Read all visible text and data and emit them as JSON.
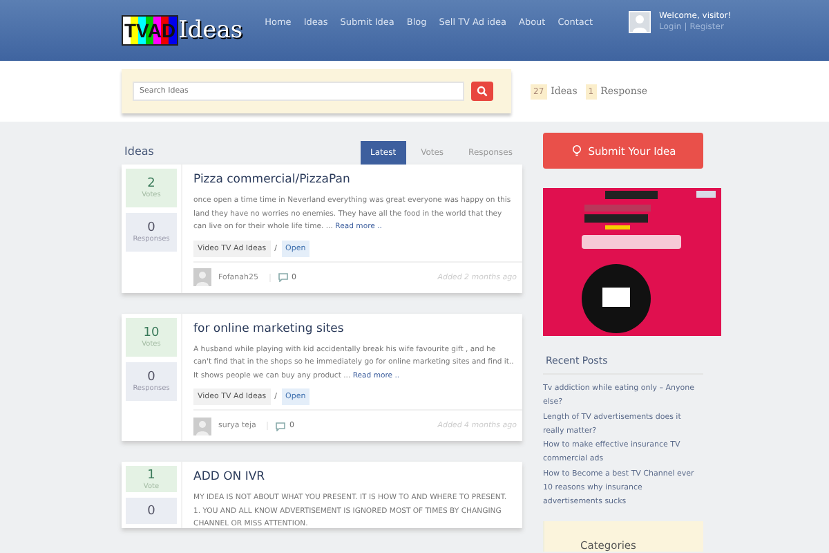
{
  "header": {
    "logo": {
      "bars_text": "TVAD",
      "word": "Ideas"
    },
    "nav": [
      {
        "label": "Home"
      },
      {
        "label": "Ideas"
      },
      {
        "label": "Submit Idea"
      },
      {
        "label": "Blog"
      },
      {
        "label": "Sell TV Ad idea"
      },
      {
        "label": "About"
      },
      {
        "label": "Contact"
      }
    ],
    "user": {
      "welcome": "Welcome, visitor!",
      "login": "Login",
      "separator": "|",
      "register": "Register"
    }
  },
  "search": {
    "placeholder": "Search Ideas"
  },
  "stats": [
    {
      "count": "27",
      "label": "Ideas"
    },
    {
      "count": "1",
      "label": "Response"
    }
  ],
  "ideas_heading": "Ideas",
  "tabs": [
    {
      "label": "Latest",
      "selected": true
    },
    {
      "label": "Votes",
      "selected": false
    },
    {
      "label": "Responses",
      "selected": false
    }
  ],
  "ideas": [
    {
      "votes": "2",
      "votes_label": "Votes",
      "responses": "0",
      "responses_label": "Responses",
      "title": "Pizza commercial/PizzaPan",
      "excerpt": "once open a time time in Neverland everything was great everyone was happy on this land they have no worries no enemies. They have all the food in the world that they can live on for their whole life time. ...",
      "read_more": "Read more ..",
      "category": "Video TV Ad Ideas",
      "separator": "/",
      "status": "Open",
      "author": "Fofanah25",
      "comments": "0",
      "added": "Added 2 months ago"
    },
    {
      "votes": "10",
      "votes_label": "Votes",
      "responses": "0",
      "responses_label": "Responses",
      "title": "for online marketing sites",
      "excerpt": "A husband while playing with kid accidentally break his wife favourite gift , and he can't find that in the shops so he immediately go for online marketing sites and find it.. It shows people we can buy any product ...",
      "read_more": "Read more ..",
      "category": "Video TV Ad Ideas",
      "separator": "/",
      "status": "Open",
      "author": "surya teja",
      "comments": "0",
      "added": "Added 4 months ago"
    },
    {
      "votes": "1",
      "votes_label": "Vote",
      "responses": "0",
      "title": "ADD ON IVR",
      "excerpt": "MY IDEA IS NOT ABOUT WHAT YOU PRESENT. IT IS HOW TO AND WHERE TO PRESENT. 1. YOU AND ALL KNOW ADVERTISEMENT IS IGNORED MOST OF TIMES BY CHANGING CHANNEL OR MISS ATTENTION."
    }
  ],
  "sidebar": {
    "submit_button": "Submit Your Idea",
    "recent_posts": {
      "title": "Recent Posts",
      "items": [
        {
          "label": "Tv addiction while eating only – Anyone else?"
        },
        {
          "label": "Length of TV advertisements does it really matter?"
        },
        {
          "label": "How to make effective insurance TV commercial ads"
        },
        {
          "label": "How to Become a best TV Channel ever"
        },
        {
          "label": "10 reasons why insurance advertisements sucks"
        }
      ]
    },
    "categories": {
      "title": "Categories"
    }
  }
}
